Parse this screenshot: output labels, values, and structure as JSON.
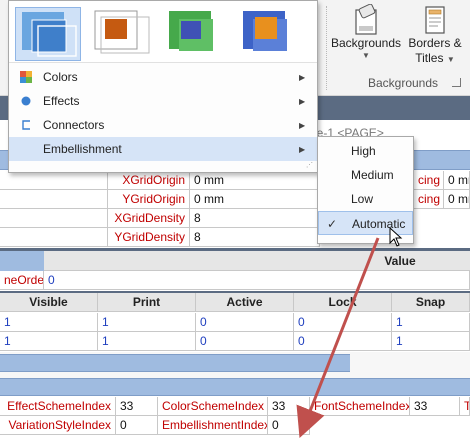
{
  "gallery": {
    "themes": [
      {
        "name": "theme-variant-1",
        "selected": true,
        "back": "#5b9bd5",
        "front": "#3a78c2"
      },
      {
        "name": "theme-variant-2",
        "selected": false,
        "back": "#ffffff",
        "front": "#c55a11"
      },
      {
        "name": "theme-variant-3",
        "selected": false,
        "back": "#4caf50",
        "front": "#3f51b5"
      },
      {
        "name": "theme-variant-4",
        "selected": false,
        "back": "#3f63c8",
        "front": "#e8901e"
      }
    ],
    "menu": [
      {
        "label": "Colors",
        "icon": "colors-icon"
      },
      {
        "label": "Effects",
        "icon": "effects-icon"
      },
      {
        "label": "Connectors",
        "icon": "connectors-icon"
      },
      {
        "label": "Embellishment",
        "icon": ""
      }
    ]
  },
  "submenu": {
    "items": [
      {
        "label": "High",
        "mnemonic": "H"
      },
      {
        "label": "Medium",
        "mnemonic": "M"
      },
      {
        "label": "Low",
        "mnemonic": "L"
      },
      {
        "label": "Automatic",
        "mnemonic": "A",
        "checked": true
      }
    ]
  },
  "ribbon": {
    "backgrounds_label": "Backgrounds",
    "borders_label": "Borders &",
    "titles_label": "Titles",
    "group_label": "Backgrounds"
  },
  "sheet": {
    "page_tab_fragment": "ge-1 <PAGE>",
    "grid": {
      "xgridorigin_label": "XGridOrigin",
      "xgridorigin_value": "0 mm",
      "ygridorigin_label": "YGridOrigin",
      "ygridorigin_value": "0 mm",
      "xgriddensity_label": "XGridDensity",
      "xgriddensity_value": "8",
      "ygriddensity_label": "YGridDensity",
      "ygriddensity_value": "8",
      "spacing_label_1": "cing",
      "spacing_value_1": "0 mr",
      "spacing_label_2": "cing",
      "spacing_value_2": "0 mr"
    },
    "value_header": "Value",
    "scheme_order_label": "neOrder",
    "scheme_order_value": "0",
    "layers": {
      "headers": [
        "Visible",
        "Print",
        "Active",
        "Lock",
        "Snap"
      ],
      "rows": [
        [
          "1",
          "1",
          "0",
          "0",
          "1"
        ],
        [
          "1",
          "1",
          "0",
          "0",
          "1"
        ]
      ]
    },
    "theme": {
      "effect_label": "EffectSchemeIndex",
      "effect_value": "33",
      "color_label": "ColorSchemeIndex",
      "color_value": "33",
      "font_label": "FontSchemeIndex",
      "font_value": "33",
      "variation_label": "VariationStyleIndex",
      "variation_value": "0",
      "embellishment_label": "EmbellishmentIndex",
      "embellishment_value": "0",
      "extra_fragment": "T"
    }
  },
  "colors": {
    "arrow": "#c0504d",
    "highlight": "#d6e4f7",
    "header_band": "#9fbbe0"
  }
}
